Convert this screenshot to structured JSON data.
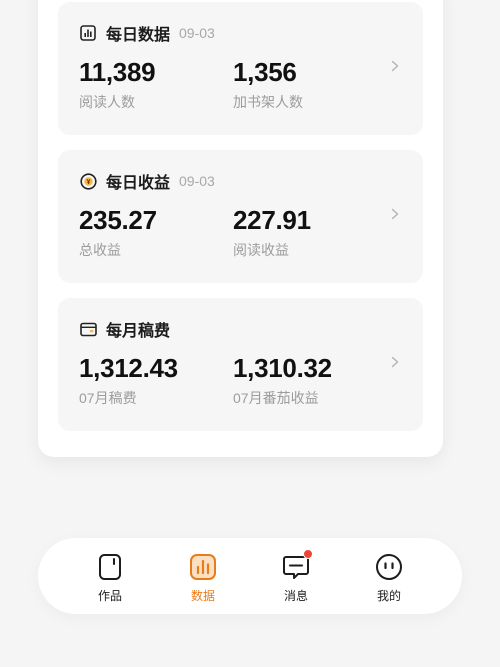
{
  "cards": [
    {
      "icon": "bar-chart-icon",
      "title": "每日数据",
      "date": "09-03",
      "stats": [
        {
          "value": "11,389",
          "label": "阅读人数"
        },
        {
          "value": "1,356",
          "label": "加书架人数"
        }
      ]
    },
    {
      "icon": "yen-coin-icon",
      "title": "每日收益",
      "date": "09-03",
      "stats": [
        {
          "value": "235.27",
          "label": "总收益"
        },
        {
          "value": "227.91",
          "label": "阅读收益"
        }
      ]
    },
    {
      "icon": "wallet-icon",
      "title": "每月稿费",
      "date": "",
      "stats": [
        {
          "value": "1,312.43",
          "label": "07月稿费"
        },
        {
          "value": "1,310.32",
          "label": "07月番茄收益"
        }
      ]
    }
  ],
  "tabbar": {
    "items": [
      {
        "label": "作品",
        "icon": "works-icon",
        "active": false
      },
      {
        "label": "数据",
        "icon": "data-icon",
        "active": true
      },
      {
        "label": "消息",
        "icon": "message-icon",
        "active": false,
        "badge": true
      },
      {
        "label": "我的",
        "icon": "profile-icon",
        "active": false
      }
    ]
  },
  "colors": {
    "accent": "#e87b1a",
    "badge": "#f04438",
    "muted_text": "#9c9c9c",
    "card_bg": "#f6f6f7",
    "page_bg": "#f5f5f6"
  }
}
